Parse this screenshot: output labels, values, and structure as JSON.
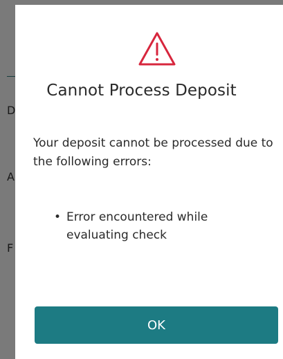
{
  "background": {
    "partial_letters": [
      "D",
      "A",
      "F"
    ]
  },
  "dialog": {
    "icon": "warning-triangle-icon",
    "title": "Cannot Process Deposit",
    "message": "Your deposit cannot be processed due to the following errors:",
    "errors": [
      "Error encountered while evaluating check"
    ],
    "button_label": "OK"
  },
  "colors": {
    "icon_red": "#d7263d",
    "button_teal": "#1d7b83",
    "text": "#2a2a2a"
  }
}
